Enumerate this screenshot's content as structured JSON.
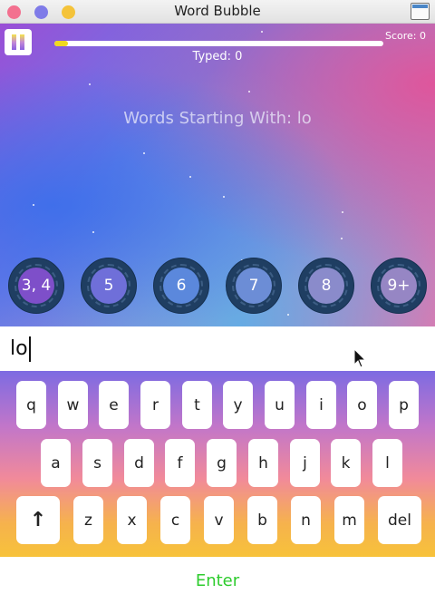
{
  "window": {
    "title": "Word Bubble"
  },
  "game": {
    "score_label": "Score: 0",
    "typed_label": "Typed: 0",
    "prompt": "Words Starting With: lo",
    "progress_fraction": 0.04,
    "bubbles": [
      "3, 4",
      "5",
      "6",
      "7",
      "8",
      "9+"
    ]
  },
  "input": {
    "value": "lo"
  },
  "keyboard": {
    "row1": [
      "q",
      "w",
      "e",
      "r",
      "t",
      "y",
      "u",
      "i",
      "o",
      "p"
    ],
    "row2": [
      "a",
      "s",
      "d",
      "f",
      "g",
      "h",
      "j",
      "k",
      "l"
    ],
    "row3": [
      "z",
      "x",
      "c",
      "v",
      "b",
      "n",
      "m"
    ],
    "shift_label": "↑",
    "delete_label": "del"
  },
  "enter_label": "Enter",
  "colors": {
    "accent_green": "#2ecc2e",
    "progress_yellow": "#f0d920",
    "bubble_dark": "#1f3e62"
  }
}
